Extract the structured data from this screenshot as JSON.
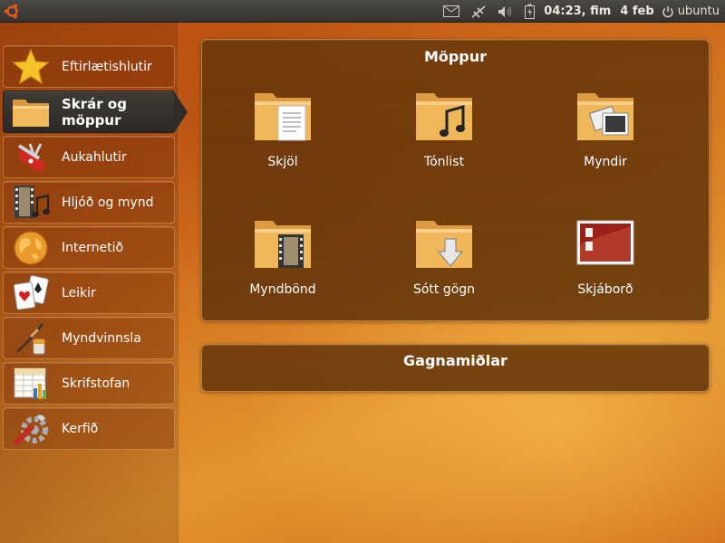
{
  "panel": {
    "clock": "04:23, fim",
    "date": "4 feb",
    "user": "ubuntu",
    "icons": [
      "ubuntu-logo-icon",
      "mail-icon",
      "network-disconnected-icon",
      "volume-icon",
      "battery-icon",
      "power-icon"
    ]
  },
  "sidebar": {
    "items": [
      {
        "label": "Eftirlætishlutir",
        "icon": "star-icon"
      },
      {
        "label": "Skrár og möppur",
        "icon": "folder-icon",
        "active": true
      },
      {
        "label": "Aukahlutir",
        "icon": "swiss-knife-icon"
      },
      {
        "label": "Hljóð og mynd",
        "icon": "film-music-icon"
      },
      {
        "label": "Internetið",
        "icon": "globe-icon"
      },
      {
        "label": "Leikir",
        "icon": "cards-icon"
      },
      {
        "label": "Myndvinnsla",
        "icon": "paint-brush-icon"
      },
      {
        "label": "Skrifstofan",
        "icon": "spreadsheet-icon"
      },
      {
        "label": "Kerfið",
        "icon": "system-tools-icon"
      }
    ]
  },
  "folders_group": {
    "title": "Möppur",
    "tiles": [
      {
        "label": "Skjöl",
        "icon": "documents-folder-icon"
      },
      {
        "label": "Tónlist",
        "icon": "music-folder-icon"
      },
      {
        "label": "Myndir",
        "icon": "pictures-folder-icon"
      },
      {
        "label": "Myndbönd",
        "icon": "videos-folder-icon"
      },
      {
        "label": "Sótt gögn",
        "icon": "downloads-folder-icon"
      },
      {
        "label": "Skjáborð",
        "icon": "desktop-icon"
      }
    ]
  },
  "media_group": {
    "title": "Gagnamiðlar"
  }
}
